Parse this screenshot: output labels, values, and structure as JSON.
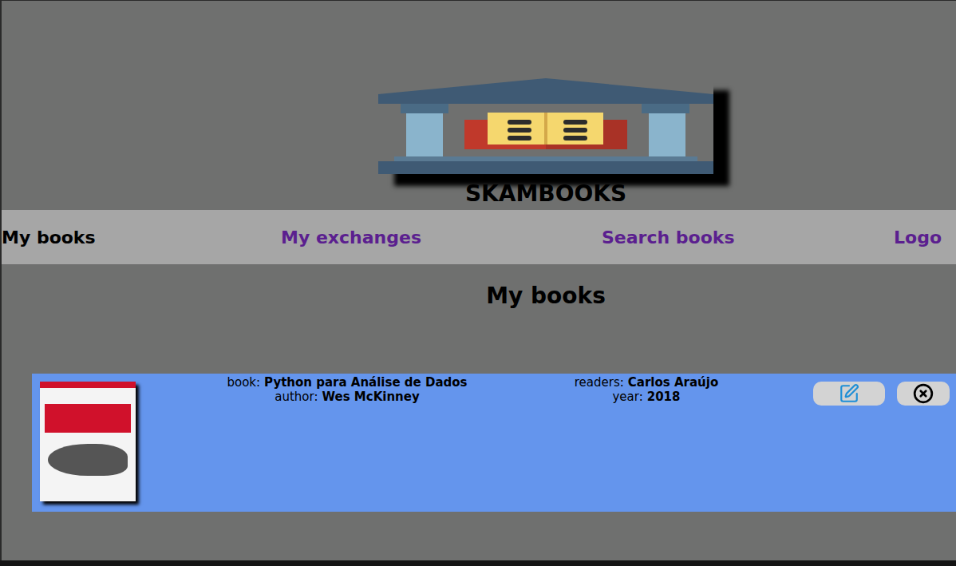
{
  "app": {
    "title": "SKAMBOOKS"
  },
  "nav": [
    {
      "label": "My books",
      "selected": true
    },
    {
      "label": "My exchanges",
      "selected": false
    },
    {
      "label": "Search books",
      "selected": false
    },
    {
      "label": "Logo",
      "selected": false
    }
  ],
  "page": {
    "heading": "My books"
  },
  "books": [
    {
      "book_label": "book:",
      "book": "Python para Análise de Dados",
      "author_label": "author:",
      "author": "Wes McKinney",
      "readers_label": "readers:",
      "readers": "Carlos Araújo",
      "year_label": "year:",
      "year": "2018"
    }
  ]
}
